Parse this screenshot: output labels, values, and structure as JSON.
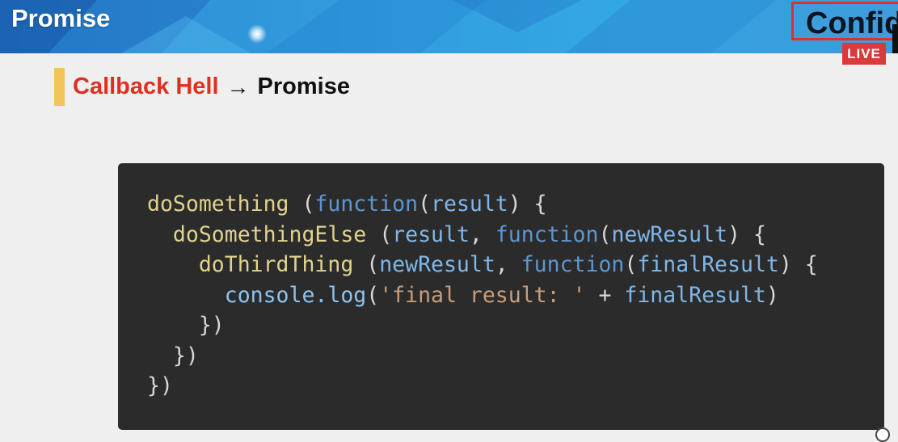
{
  "header": {
    "title": "Promise",
    "badge_text": "Confid",
    "live_label": "LIVE"
  },
  "subtitle": {
    "red_text": "Callback Hell",
    "arrow": "→",
    "dark_text": "Promise"
  },
  "code": {
    "line1": {
      "fn": "doSomething",
      "p1": " (",
      "kw": "function",
      "p2": "(",
      "var": "result",
      "p3": ") {"
    },
    "line2": {
      "indent": "  ",
      "fn": "doSomethingElse",
      "p1": " (",
      "var1": "result",
      "p2": ", ",
      "kw": "function",
      "p3": "(",
      "var2": "newResult",
      "p4": ") {"
    },
    "line3": {
      "indent": "    ",
      "fn": "doThirdThing",
      "p1": " (",
      "var1": "newResult",
      "p2": ", ",
      "kw": "function",
      "p3": "(",
      "var2": "finalResult",
      "p4": ") {"
    },
    "line4": {
      "indent": "      ",
      "obj": "console.log",
      "p1": "(",
      "str": "'final result: '",
      "p2": " + ",
      "var": "finalResult",
      "p3": ")"
    },
    "line5": "    })",
    "line6": "  })",
    "line7": "})"
  },
  "colors": {
    "header_blue": "#2b8fd6",
    "accent_yellow": "#f2c45a",
    "title_red": "#e02f1f",
    "live_red": "#d93a3a",
    "code_bg": "#2b2b2c"
  }
}
